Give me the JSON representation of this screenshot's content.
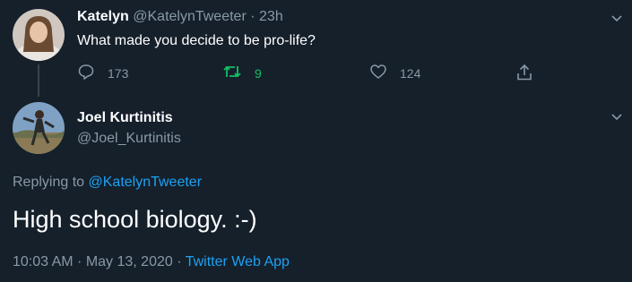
{
  "colors": {
    "background": "#15202b",
    "text": "#ffffff",
    "muted": "#8899a6",
    "link": "#1da1f2",
    "retweet": "#17bf63"
  },
  "parent_tweet": {
    "author_name": "Katelyn",
    "author_handle": "@KatelynTweeter",
    "separator": "·",
    "time_ago": "23h",
    "text": "What made you decide to be pro-life?",
    "actions": {
      "reply_count": "173",
      "retweet_count": "9",
      "like_count": "124"
    },
    "icons": {
      "avatar": "avatar-katelyn",
      "menu": "chevron-down-icon",
      "reply": "reply-icon",
      "retweet": "retweet-icon",
      "like": "heart-icon",
      "share": "share-icon"
    }
  },
  "main_tweet": {
    "author_name": "Joel Kurtinitis",
    "author_handle": "@Joel_Kurtinitis",
    "replying_prefix": "Replying to",
    "replying_to": "@KatelynTweeter",
    "text": "High school biology. :-)",
    "timestamp": "10:03 AM · May 13, 2020",
    "timestamp_separator": "·",
    "source": "Twitter Web App",
    "icons": {
      "avatar": "avatar-joel",
      "menu": "chevron-down-icon"
    }
  }
}
